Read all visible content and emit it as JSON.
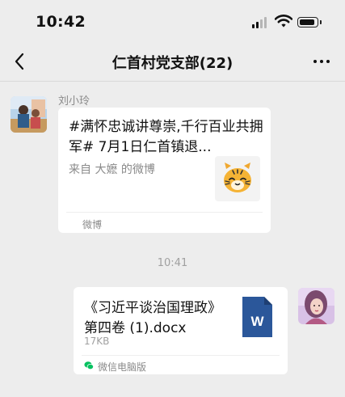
{
  "status_bar": {
    "time": "10:42"
  },
  "header": {
    "title": "仁首村党支部(22)"
  },
  "messages": [
    {
      "type": "link-card",
      "sender": "刘小玲",
      "title": "#满怀忠诚讲尊崇,千行百业共拥军# 7月1日仁首镇退...",
      "source": "来自 大嬷 的微博",
      "app_name": "微博"
    },
    {
      "type": "file-card",
      "file_name": "《习近平谈治国理政》第四卷 (1).docx",
      "file_size": "17KB",
      "app_name": "微信电脑版",
      "file_icon_letter": "W"
    }
  ],
  "timestamp": "10:41",
  "icons": {
    "back": "chevron-left-icon",
    "more": "ellipsis-icon",
    "word": "word-document-icon",
    "wechat": "wechat-icon"
  },
  "colors": {
    "background": "#ededed",
    "card": "#ffffff",
    "word_blue": "#2b579a",
    "wechat_green": "#07c160"
  }
}
